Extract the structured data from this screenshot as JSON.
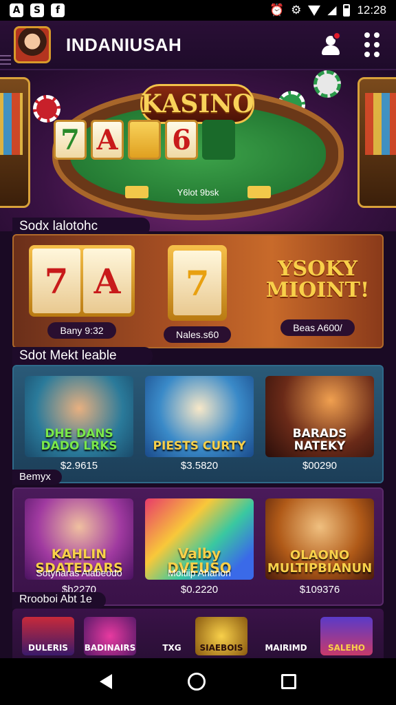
{
  "status_bar": {
    "time": "12:28",
    "icons": [
      "a-icon",
      "s-icon",
      "f-icon"
    ]
  },
  "appbar": {
    "title": "INDANIUSAH"
  },
  "hero": {
    "logo": "KASINO",
    "subtitle": "Y6lot 9bsk",
    "reels": [
      "7",
      "A",
      "",
      "6",
      ""
    ]
  },
  "featured": {
    "label": "Sodx lalotohc",
    "items": [
      {
        "caption": "Bany 9:32",
        "reels": [
          "7",
          "A"
        ]
      },
      {
        "caption": "Nales.s60",
        "reels": [
          "7"
        ]
      },
      {
        "caption": "Beas A600/",
        "title": "YSOKY MIOINT!"
      }
    ]
  },
  "slots": {
    "label": "Sdot Mekt leable",
    "footer_label": "Bemyx",
    "cards": [
      {
        "title": "DHE DANS DADO LRKS",
        "price": "$2.9615"
      },
      {
        "title": "PIESTS CURTY",
        "price": "$3.5820"
      },
      {
        "title": "BARADS NATEKY",
        "price": "$00290"
      }
    ]
  },
  "jackpots": {
    "label": "Rrooboi Abt 1e",
    "cards": [
      {
        "title": "KAHLIN SDATEDARS",
        "sublabel": "Sotynaras Alabeodo",
        "price": "$b2270"
      },
      {
        "title": "Valby DVEUSO",
        "sublabel": "Moltiip Ahanon",
        "price": "$0.2220"
      },
      {
        "title": "OLAONO MULTIPBIANUN",
        "sublabel": "",
        "price": "$109376"
      }
    ]
  },
  "bottom_icons": [
    "DULERIS",
    "BADINAIRS",
    "TXG",
    "SIAEBOIS",
    "MAIRIMD",
    "SALEHO"
  ]
}
